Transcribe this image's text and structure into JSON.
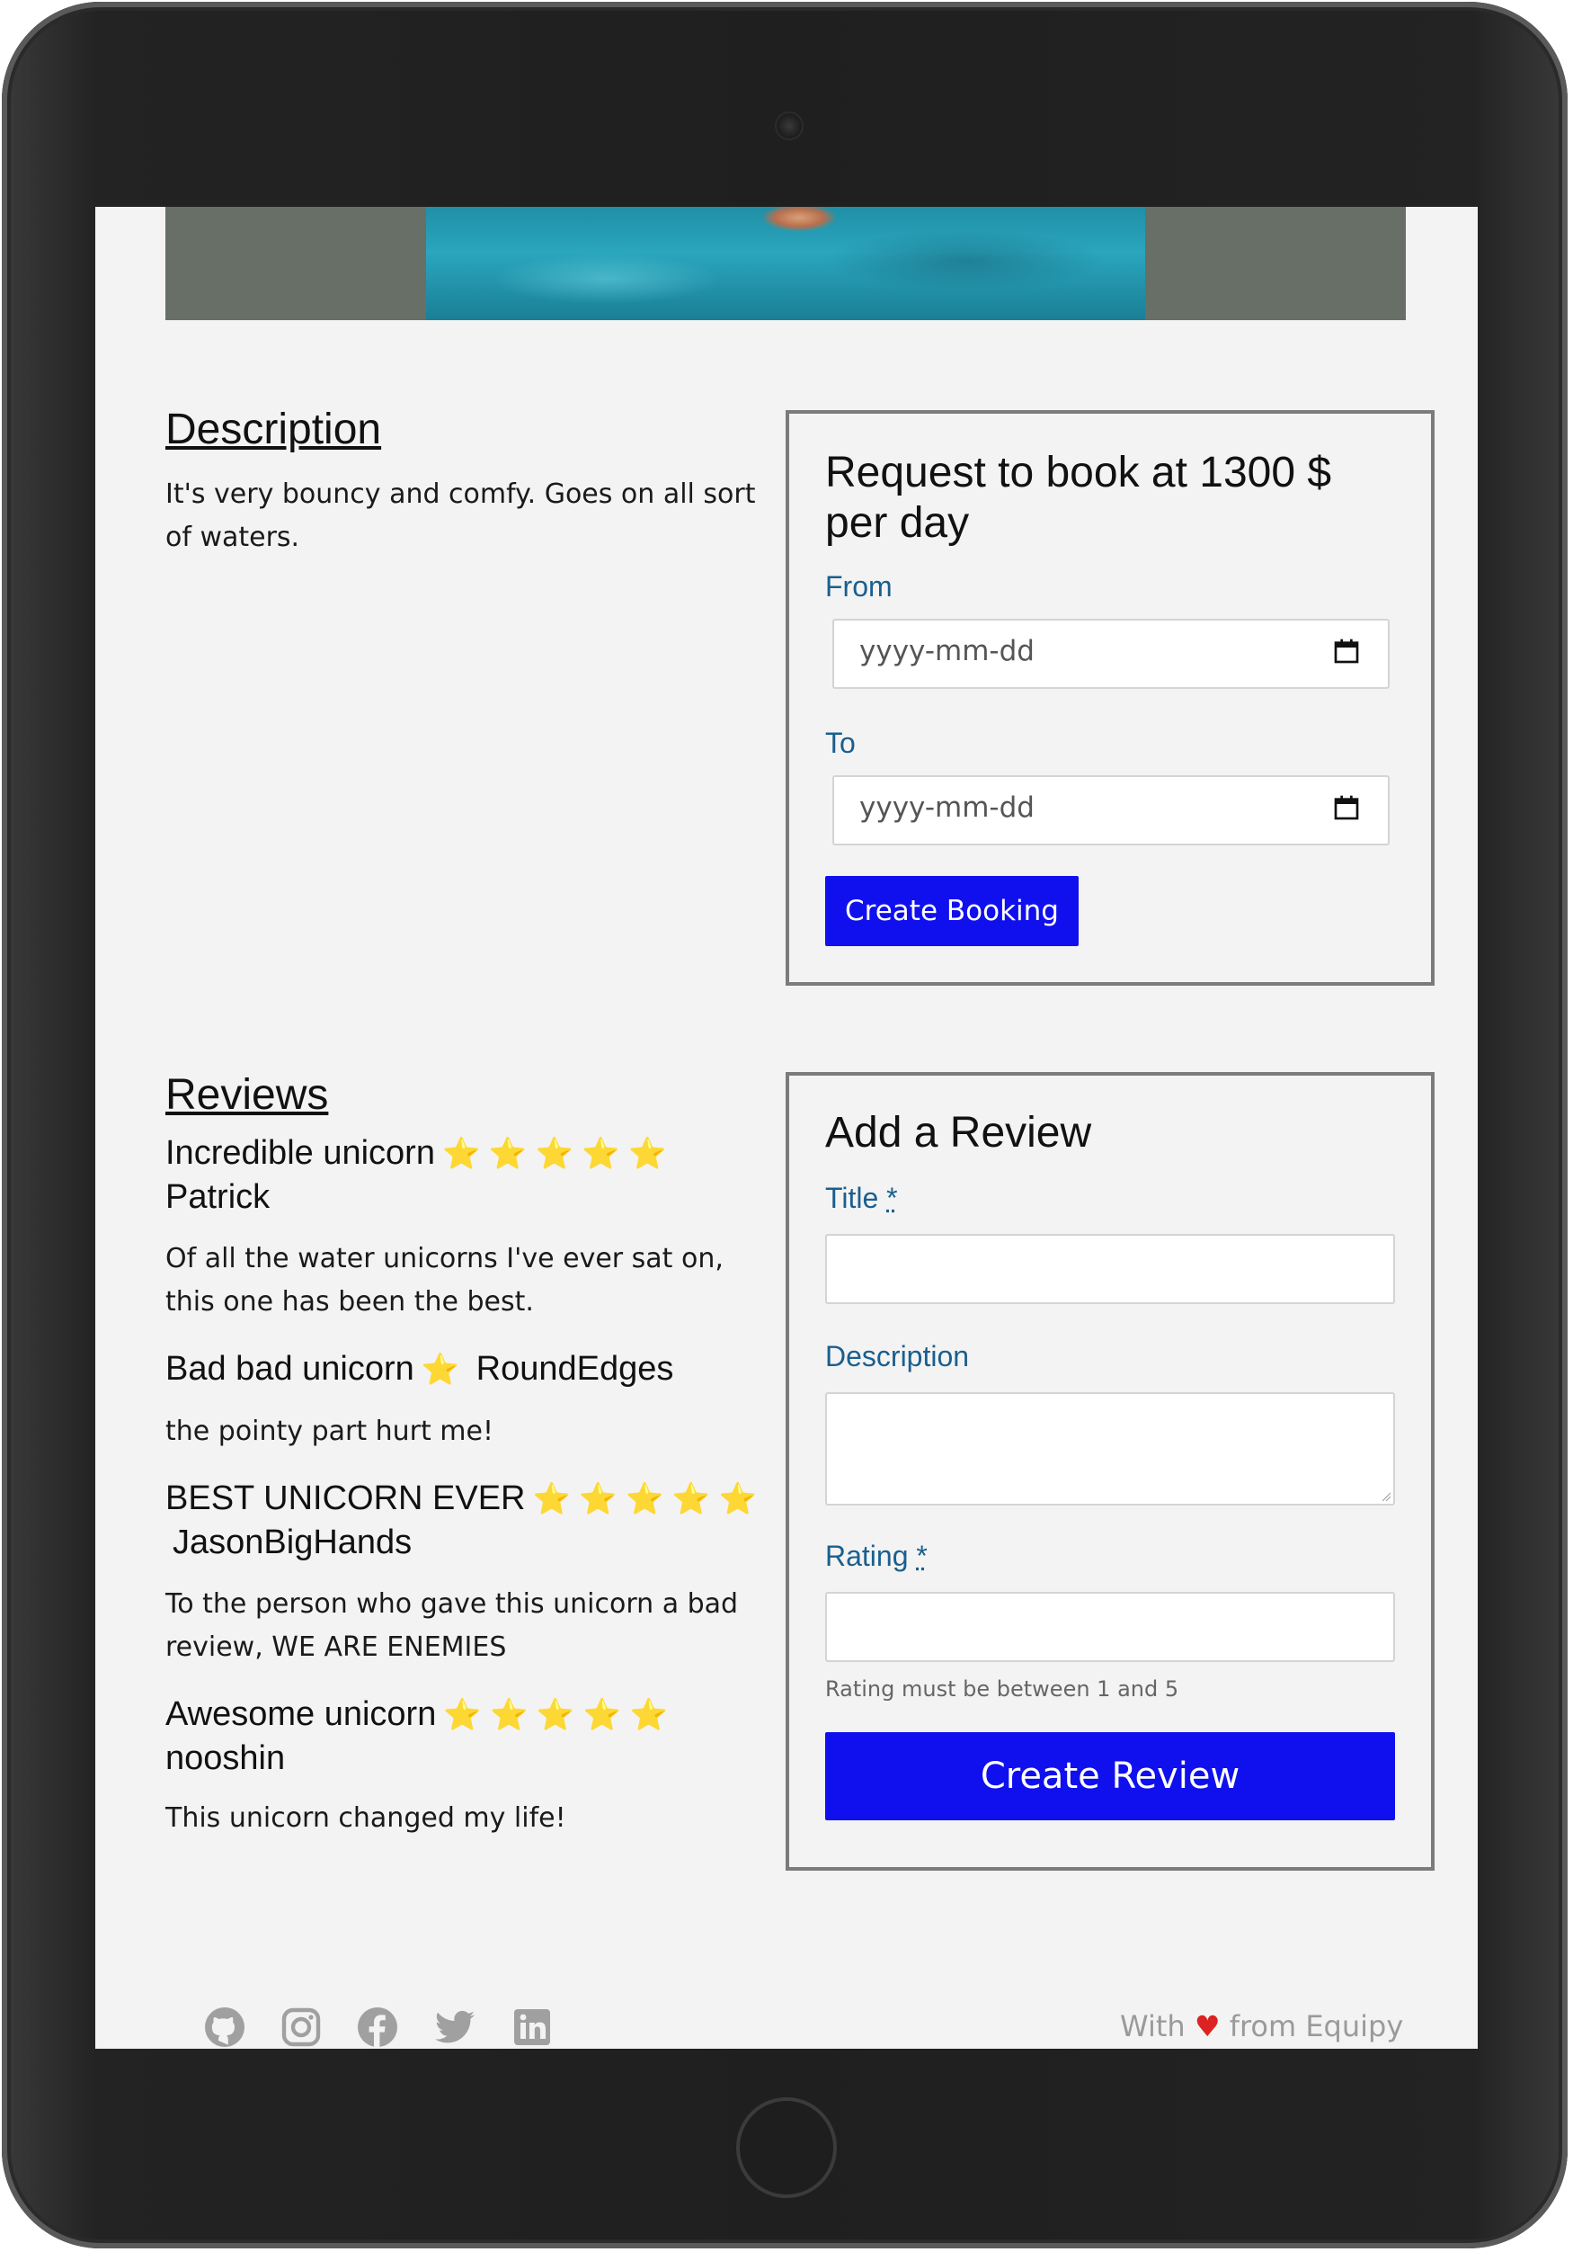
{
  "description": {
    "heading": "Description",
    "text": "It's very bouncy and comfy. Goes on all sort of waters."
  },
  "booking": {
    "title": "Request to book at 1300 $ per day",
    "from_label": "From",
    "from_placeholder": "yyyy-mm-dd",
    "to_label": "To",
    "to_placeholder": "yyyy-mm-dd",
    "button_label": "Create Booking"
  },
  "reviews": {
    "heading": "Reviews",
    "items": [
      {
        "title": "Incredible unicorn",
        "stars": "⭐ ⭐ ⭐ ⭐ ⭐",
        "author": "Patrick",
        "text": "Of all the water unicorns I've ever sat on, this one has been the best."
      },
      {
        "title": "Bad bad unicorn",
        "stars": "⭐",
        "author": "RoundEdges",
        "text": "the pointy part hurt me!"
      },
      {
        "title": "BEST UNICORN EVER",
        "stars": "⭐ ⭐ ⭐ ⭐ ⭐",
        "author": "JasonBigHands",
        "text": "To the person who gave this unicorn a bad review, WE ARE ENEMIES"
      },
      {
        "title": "Awesome unicorn",
        "stars": "⭐ ⭐ ⭐ ⭐ ⭐",
        "author": "nooshin",
        "text": "This unicorn changed my life!"
      }
    ]
  },
  "add_review": {
    "title": "Add a Review",
    "title_label": "Title",
    "required_mark": "*",
    "description_label": "Description",
    "rating_label": "Rating",
    "rating_help": "Rating must be between 1 and 5",
    "button_label": "Create Review"
  },
  "footer": {
    "icons": [
      "github-icon",
      "instagram-icon",
      "facebook-icon",
      "twitter-icon",
      "linkedin-icon"
    ],
    "text_prefix": "With",
    "heart": "♥",
    "text_suffix": "from Equipy"
  },
  "colors": {
    "primary_button": "#1010ee",
    "label_blue": "#1a5f8e",
    "heart_red": "#dd2222"
  }
}
